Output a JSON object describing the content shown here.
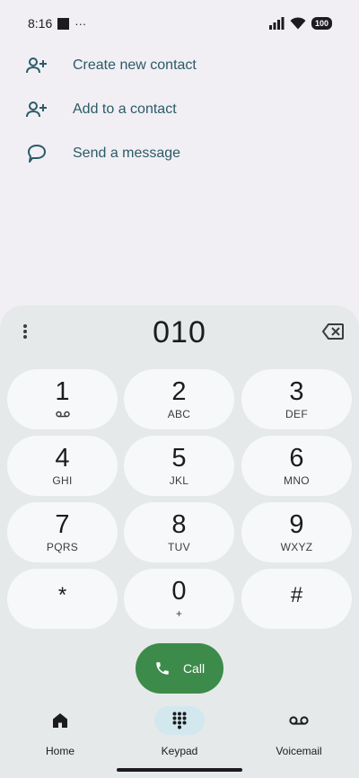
{
  "status_bar": {
    "time": "8:16",
    "dots": "···",
    "battery": "100"
  },
  "actions": [
    {
      "label": "Create new contact",
      "icon": "add-person-icon"
    },
    {
      "label": "Add to a contact",
      "icon": "add-person-icon"
    },
    {
      "label": "Send a message",
      "icon": "message-bubble-icon"
    }
  ],
  "dialer": {
    "digits": "010"
  },
  "keypad": [
    {
      "num": "1",
      "letters": ""
    },
    {
      "num": "2",
      "letters": "ABC"
    },
    {
      "num": "3",
      "letters": "DEF"
    },
    {
      "num": "4",
      "letters": "GHI"
    },
    {
      "num": "5",
      "letters": "JKL"
    },
    {
      "num": "6",
      "letters": "MNO"
    },
    {
      "num": "7",
      "letters": "PQRS"
    },
    {
      "num": "8",
      "letters": "TUV"
    },
    {
      "num": "9",
      "letters": "WXYZ"
    },
    {
      "num": "*",
      "letters": ""
    },
    {
      "num": "0",
      "letters": "+"
    },
    {
      "num": "#",
      "letters": ""
    }
  ],
  "call": {
    "label": "Call"
  },
  "nav": {
    "home": "Home",
    "keypad": "Keypad",
    "voicemail": "Voicemail"
  },
  "colors": {
    "accent_text": "#2a5b67",
    "call_green": "#3d8b4a",
    "active_pill": "#d2e8ee"
  }
}
